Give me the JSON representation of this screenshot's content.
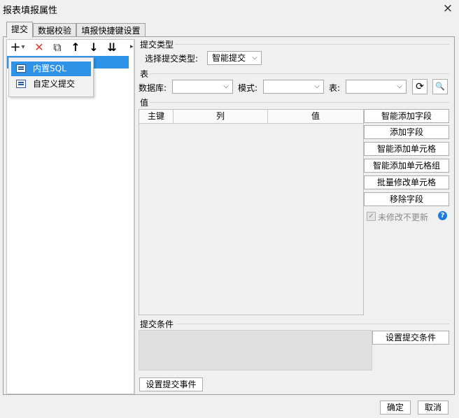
{
  "window": {
    "title": "报表填报属性",
    "close_icon": "×"
  },
  "tabs": [
    {
      "label": "提交"
    },
    {
      "label": "数据校验"
    },
    {
      "label": "填报快捷键设置"
    }
  ],
  "toolbar": {
    "add_icon": "+",
    "dropdown_icon": "▾",
    "delete_icon": "✕",
    "copy_icon": "⧉",
    "up_icon": "↑",
    "down_icon": "↓",
    "order_icon": "⇊"
  },
  "add_menu": {
    "items": [
      {
        "label": "内置SQL"
      },
      {
        "label": "自定义提交"
      }
    ]
  },
  "submit_type": {
    "section_title": "提交类型",
    "label": "选择提交类型:",
    "value": "智能提交"
  },
  "table_section": {
    "title": "表",
    "db_label": "数据库:",
    "schema_label": "模式:",
    "table_label": "表:",
    "refresh_icon": "⟳",
    "preview_icon": "🔍"
  },
  "value_section": {
    "title": "值",
    "columns": [
      "主键",
      "列",
      "值"
    ],
    "buttons": {
      "smart_add_field": "智能添加字段",
      "add_field": "添加字段",
      "smart_add_cell": "智能添加单元格",
      "smart_add_cell_group": "智能添加单元格组",
      "batch_edit_cell": "批量修改单元格",
      "remove_field": "移除字段"
    },
    "no_update_label": "未修改不更新",
    "no_update_checked": true,
    "help_icon": "?"
  },
  "condition_section": {
    "title": "提交条件",
    "set_condition_button": "设置提交条件"
  },
  "event_button": "设置提交事件",
  "footer": {
    "ok": "确定",
    "cancel": "取消"
  }
}
